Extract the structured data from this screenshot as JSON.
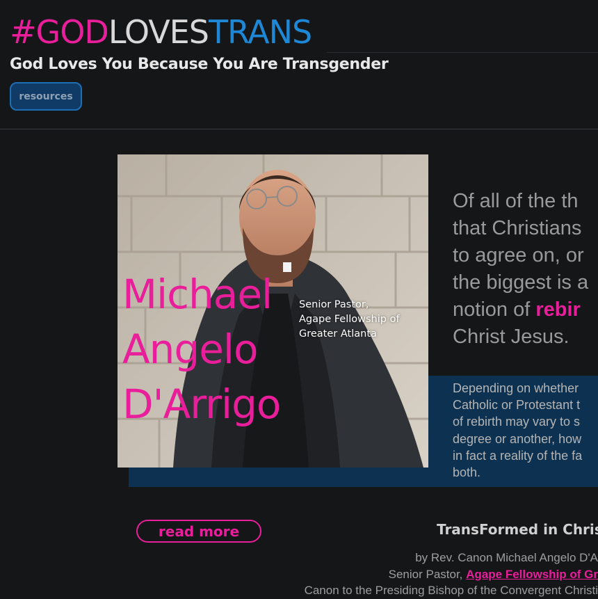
{
  "header": {
    "brand_part1": "#GOD",
    "brand_part2": "LOVES",
    "brand_part3": "TRANS",
    "tagline": "God Loves You Because You Are Transgender",
    "resources_label": "resources"
  },
  "feature": {
    "photo_name_lines": [
      "Michael",
      "Angelo",
      "D'Arrigo"
    ],
    "photo_title_lines": [
      "Senior Pastor,",
      "Agape Fellowship of",
      "Greater Atlanta"
    ],
    "quote_lines": [
      "Of all of the th",
      "that Christians",
      "to agree on, or",
      "the biggest is a"
    ],
    "quote_line5_prefix": "notion of ",
    "quote_line5_highlight": "rebir",
    "quote_line6": "Christ Jesus.",
    "paragraph_lines": [
      "Depending on whether",
      "Catholic or Protestant t",
      "of rebirth may vary to s",
      "degree or another, how",
      "in fact a reality of the fa",
      "both."
    ]
  },
  "article": {
    "read_more_label": "read more",
    "title": "TransFormed in Chris",
    "byline": "by Rev. Canon Michael Angelo D'A",
    "role_prefix": "Senior Pastor, ",
    "role_link": "Agape Fellowship of Gr",
    "role_line2": "Canon to the Presiding Bishop of the Convergent Christi"
  },
  "colors": {
    "background": "#151618",
    "pink_accent": "#e91e9b",
    "blue_accent": "#1e88d6",
    "band_blue": "#0d3150"
  },
  "icons": []
}
